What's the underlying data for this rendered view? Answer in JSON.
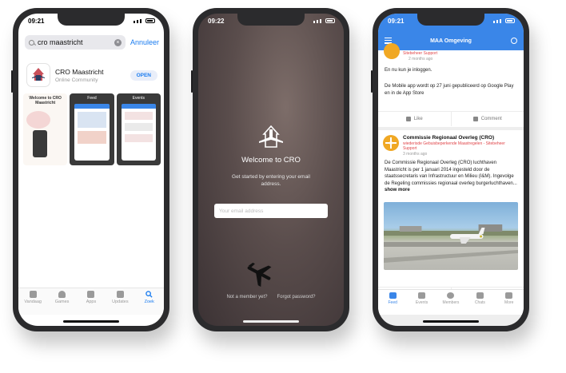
{
  "phone1": {
    "time": "09:21",
    "search_value": "cro maastricht",
    "cancel_label": "Annuleer",
    "app_name": "CRO Maastricht",
    "app_category": "Online Community",
    "open_label": "OPEN",
    "screenshot1_title": "Welcome to CRO Maastricht",
    "screenshot2_title": "Feed",
    "screenshot3_title": "Events",
    "tabs": [
      {
        "label": "Vandaag",
        "icon": "today-icon"
      },
      {
        "label": "Games",
        "icon": "rocket-icon"
      },
      {
        "label": "Apps",
        "icon": "layers-icon"
      },
      {
        "label": "Updates",
        "icon": "download-icon"
      },
      {
        "label": "Zoek",
        "icon": "search-icon"
      }
    ]
  },
  "phone2": {
    "time": "09:22",
    "welcome_title": "Welcome to CRO",
    "welcome_subtitle": "Get started by entering your email address.",
    "email_placeholder": "Your email address",
    "not_member_label": "Not a member yet?",
    "forgot_password_label": "Forgot password?"
  },
  "phone3": {
    "time": "09:21",
    "header_title": "MAA Omgeving",
    "post1": {
      "author_sub": "Sitebeheer Support",
      "time": "2 months ago",
      "text1": "En nu kun je inloggen.",
      "text2": "De Mobile app wordt op 27 juni gepubliceerd op Google Play en in de App Store"
    },
    "post2": {
      "author": "Commissie Regionaal Overleg (CRO)",
      "author_sub": "wiederisde Gebuisbeperkende Maastregelen - Sitebeheer Support",
      "time": "3 months ago",
      "text": "De Commissie Regionaal Overleg (CRO) luchthaven Maastricht is per 1 januari 2014 ingesteld door de staatssecretaris van Infrastructuur en Milieu (I&M). Ingevolge de Regeling commissies regionaal overleg burgerluchthaven...",
      "show_more": "show more"
    },
    "like_label": "Like",
    "comment_label": "Comment",
    "tabs": [
      {
        "label": "Feed",
        "icon": "home-icon"
      },
      {
        "label": "Events",
        "icon": "calendar-icon"
      },
      {
        "label": "Members",
        "icon": "people-icon"
      },
      {
        "label": "Chats",
        "icon": "chat-icon"
      },
      {
        "label": "More",
        "icon": "menu-icon"
      }
    ]
  },
  "colors": {
    "ios_blue": "#1a7cf0",
    "header_blue": "#3a86e8",
    "avatar_orange": "#f0a824",
    "alert_red": "#e0464a"
  }
}
